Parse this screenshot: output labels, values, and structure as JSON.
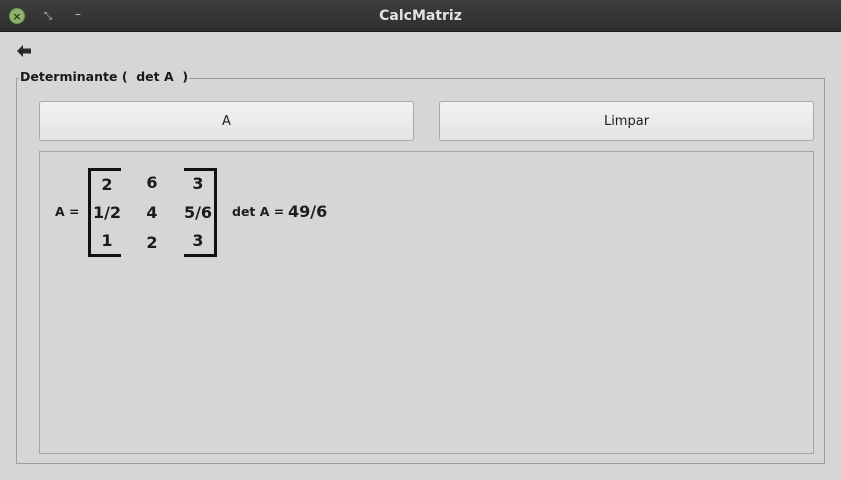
{
  "window": {
    "title": "CalcMatriz",
    "close_icon": "close-icon",
    "restore_icon": "restore-icon",
    "minimize_icon": "minimize-icon"
  },
  "toolbar": {
    "back_icon": "arrow-left-icon"
  },
  "group": {
    "legend": "Determinante (  det A  )"
  },
  "buttons": {
    "a_label": "A",
    "limpar_label": "Limpar"
  },
  "result": {
    "matrix_label": "A =",
    "matrix": [
      [
        "2",
        "6",
        "3"
      ],
      [
        "1/2",
        "4",
        "5/6"
      ],
      [
        "1",
        "2",
        "3"
      ]
    ],
    "det_label": "det A =",
    "det_value": "49/6"
  },
  "colors": {
    "titlebar": "#2f2f2f",
    "background": "#d6d6d6",
    "close_button": "#8fb56c"
  }
}
